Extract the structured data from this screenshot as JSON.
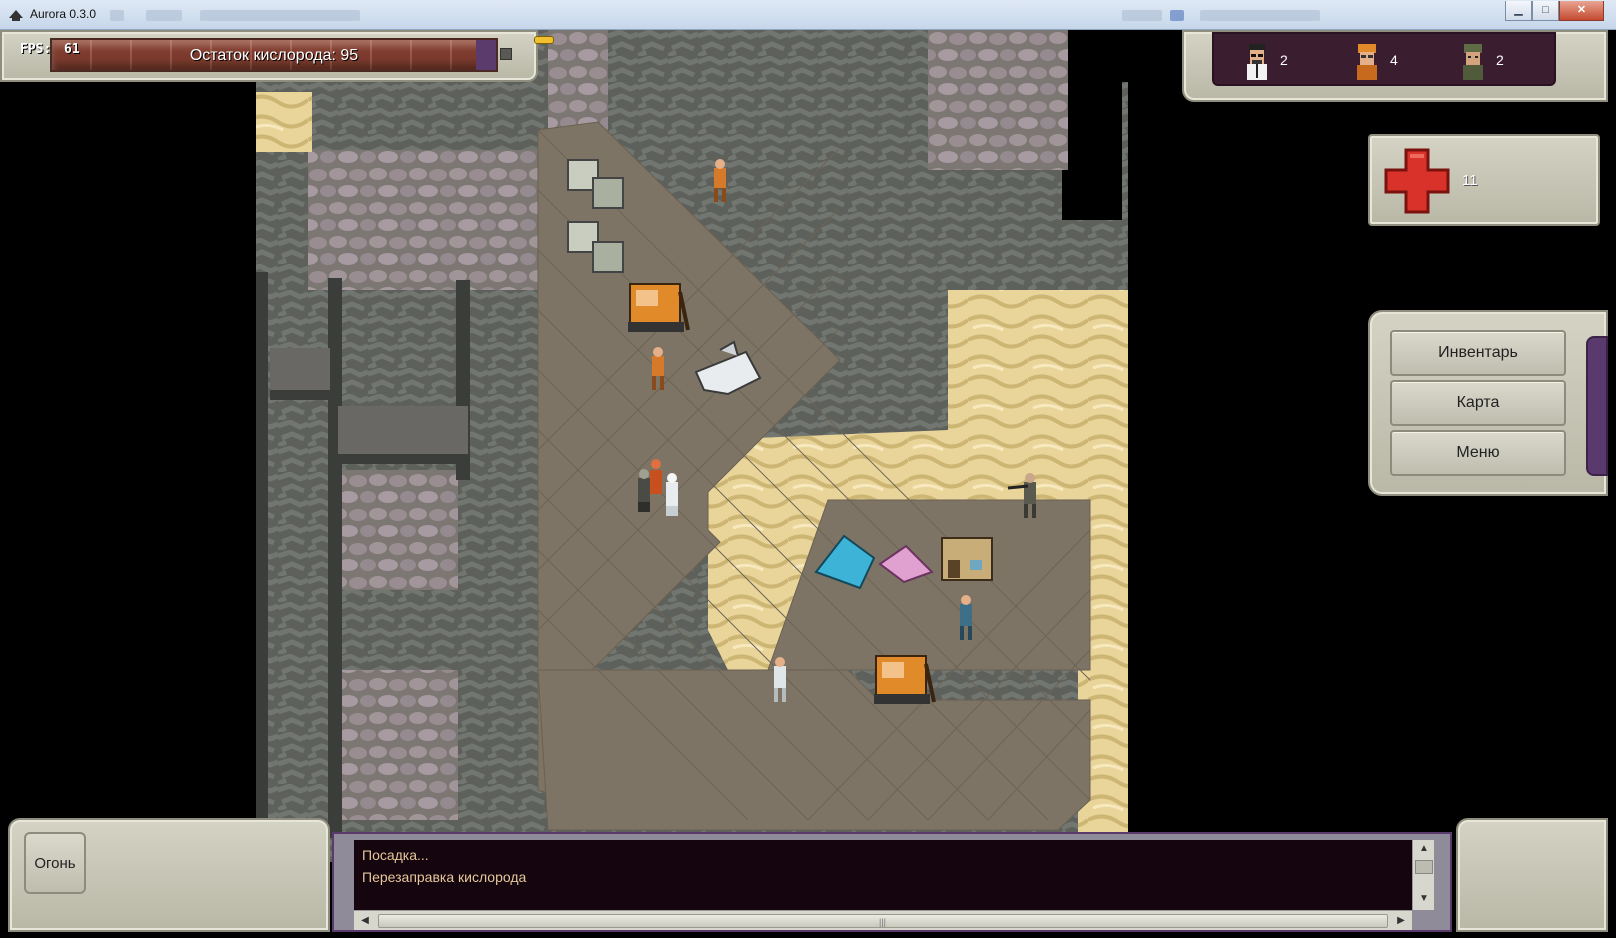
{
  "window": {
    "title": "Aurora 0.3.0",
    "controls": {
      "minimize": "▁",
      "maximize": "□",
      "close": "✕"
    }
  },
  "hud": {
    "fps_label": "FPS:",
    "fps_value": "61",
    "oxygen_text": "Остаток кислорода: 95"
  },
  "crew": {
    "scientists": "2",
    "engineers": "4",
    "military": "2"
  },
  "medkits": {
    "count": "11"
  },
  "menu": {
    "inventory": "Инвентарь",
    "map": "Карта",
    "menu": "Меню"
  },
  "actions": {
    "fire": "Огонь"
  },
  "log": {
    "lines": [
      "Посадка...",
      "Перезаправка кислорода"
    ]
  },
  "colors": {
    "panel": "#c8c7b8",
    "log_bg": "#14050e",
    "log_text": "#e6c79a",
    "accent_purple": "#5a3a6c",
    "oxygen_bar": "#7d3b2e"
  },
  "icons": {
    "app": "ship-icon",
    "med": "red-cross-icon"
  }
}
